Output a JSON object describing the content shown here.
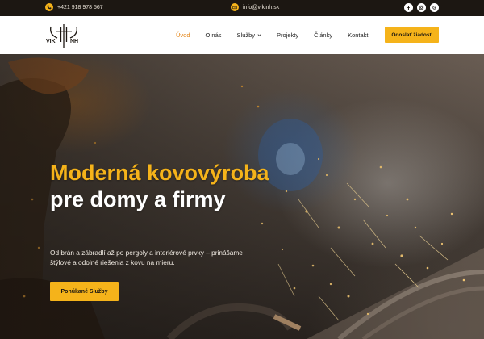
{
  "topbar": {
    "phone": "+421 918 978 567",
    "email": "info@vikinh.sk",
    "social": [
      {
        "icon": "facebook-icon"
      },
      {
        "icon": "instagram-icon"
      },
      {
        "icon": "google-icon"
      }
    ]
  },
  "logo": {
    "text": "VIK NH"
  },
  "nav": {
    "items": [
      {
        "label": "Úvod",
        "active": true
      },
      {
        "label": "O nás"
      },
      {
        "label": "Služby",
        "dropdown": true
      },
      {
        "label": "Projekty"
      },
      {
        "label": "Články"
      },
      {
        "label": "Kontakt"
      }
    ],
    "cta": "Odoslať žiadosť"
  },
  "hero": {
    "title_highlight": "Moderná kovovýroba",
    "title_rest": "pre domy a firmy",
    "subtitle": "Od brán a zábradlí až po pergoly a interiérové prvky – prinášame štýlové a odolné riešenia z kovu na mieru.",
    "cta": "Ponúkané Služby"
  },
  "colors": {
    "accent": "#f5b31a",
    "active_nav": "#e5871a",
    "topbar_bg": "#1c1712"
  }
}
